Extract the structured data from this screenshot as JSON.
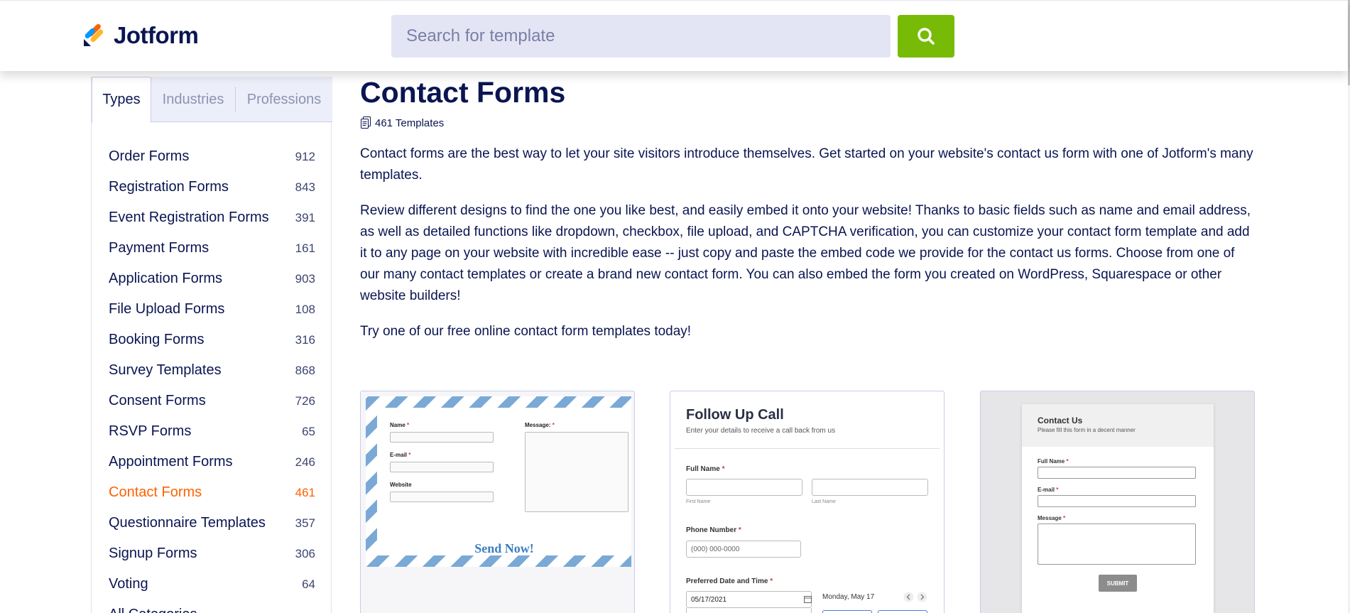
{
  "header": {
    "brand": "Jotform",
    "search_placeholder": "Search for template"
  },
  "sidebar": {
    "tabs": [
      "Types",
      "Industries",
      "Professions"
    ],
    "active_tab": "Types",
    "categories": [
      {
        "label": "Order Forms",
        "count": "912"
      },
      {
        "label": "Registration Forms",
        "count": "843"
      },
      {
        "label": "Event Registration Forms",
        "count": "391"
      },
      {
        "label": "Payment Forms",
        "count": "161"
      },
      {
        "label": "Application Forms",
        "count": "903"
      },
      {
        "label": "File Upload Forms",
        "count": "108"
      },
      {
        "label": "Booking Forms",
        "count": "316"
      },
      {
        "label": "Survey Templates",
        "count": "868"
      },
      {
        "label": "Consent Forms",
        "count": "726"
      },
      {
        "label": "RSVP Forms",
        "count": "65"
      },
      {
        "label": "Appointment Forms",
        "count": "246"
      },
      {
        "label": "Contact Forms",
        "count": "461"
      },
      {
        "label": "Questionnaire Templates",
        "count": "357"
      },
      {
        "label": "Signup Forms",
        "count": "306"
      },
      {
        "label": "Voting",
        "count": "64"
      },
      {
        "label": "All Categories",
        "count": ""
      }
    ],
    "active_category": "Contact Forms"
  },
  "main": {
    "title": "Contact Forms",
    "template_count": "461 Templates",
    "paragraphs": [
      "Contact forms are the best way to let your site visitors introduce themselves. Get started on your website's contact us form with one of Jotform's many templates.",
      "Review different designs to find the one you like best, and easily embed it onto your website! Thanks to basic fields such as name and email address, as well as detailed functions like dropdown, checkbox, file upload, and CAPTCHA verification, you can customize your contact form template and add it to any page on your website with incredible ease -- just copy and paste the embed code we provide for the contact us forms. Choose from one of our many contact templates or create a brand new contact form. You can also embed the form you created on WordPress, Squarespace or other website builders!",
      "Try one of our free online contact form templates today!"
    ]
  },
  "cards": {
    "card1": {
      "name_label": "Name",
      "email_label": "E-mail",
      "website_label": "Website",
      "message_label": "Message:",
      "button": "Send Now!"
    },
    "card2": {
      "title": "Follow Up Call",
      "subtitle": "Enter your details to receive a call back from us",
      "full_name_label": "Full Name",
      "first_name_hint": "First Name",
      "last_name_hint": "Last Name",
      "phone_label": "Phone Number",
      "phone_placeholder": "(000) 000-0000",
      "date_label": "Preferred Date and Time",
      "date_value": "05/17/2021",
      "calendar_heading": "Monday, May 17"
    },
    "card3": {
      "title": "Contact Us",
      "subtitle": "Please fill this form in a decent manner",
      "full_name_label": "Full Name",
      "email_label": "E-mail",
      "message_label": "Message",
      "button": "SUBMIT"
    }
  },
  "colors": {
    "brand_navy": "#0a1551",
    "search_green": "#78bb07",
    "active_orange": "#ff6100"
  },
  "icons": [
    "jotform-logo-icon",
    "search-icon",
    "templates-doc-icon",
    "calendar-icon",
    "chevron-left-icon",
    "chevron-right-icon"
  ]
}
